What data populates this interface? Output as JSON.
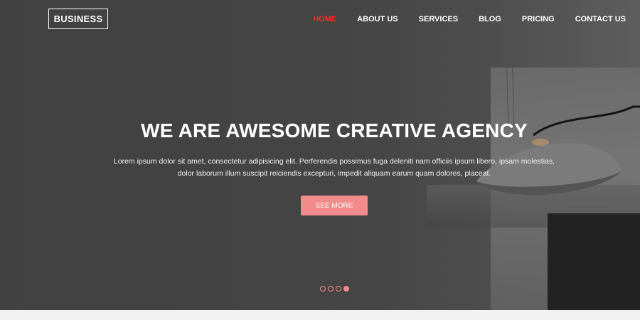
{
  "brand": {
    "logo_text": "BUSINESS"
  },
  "nav": {
    "items": [
      {
        "label": "HOME",
        "active": true
      },
      {
        "label": "ABOUT US",
        "active": false
      },
      {
        "label": "SERVICES",
        "active": false
      },
      {
        "label": "BLOG",
        "active": false
      },
      {
        "label": "PRICING",
        "active": false
      },
      {
        "label": "CONTACT US",
        "active": false
      }
    ],
    "active_color": "#ff2a2a"
  },
  "hero": {
    "headline": "WE ARE AWESOME CREATIVE AGENCY",
    "text_line1": "Lorem ipsum dolor sit amet, consectetur adipisicing elit. Perferendis possimus fuga deleniti nam officiis ipsum libero, ipsam molestias,",
    "text_line2": "dolor laborum illum suscipit reiciendis excepturi, impedit aliquam earum quam dolores, placeat.",
    "button_label": "SEE MORE",
    "accent_color": "#f28b8b",
    "slides_total": 4,
    "slide_active": 4
  }
}
